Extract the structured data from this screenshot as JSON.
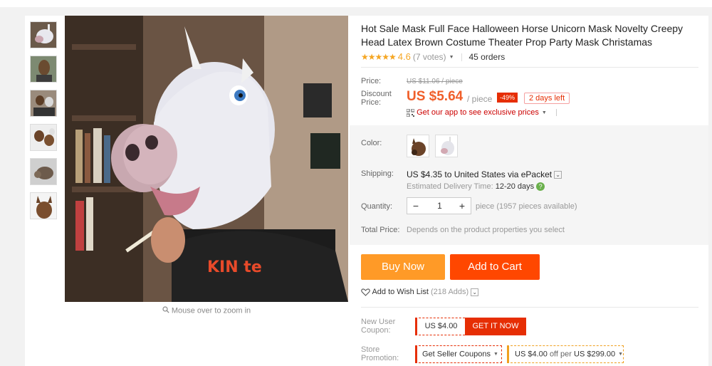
{
  "product": {
    "title": "Hot Sale Mask Full Face Halloween Horse Unicorn Mask Novelty Creepy Head Latex Brown Costume Theater Prop Party Mask Christamas",
    "rating_stars": "★★★★★",
    "rating_score": "4.6",
    "votes": "(7 votes)",
    "orders": "45 orders"
  },
  "gallery": {
    "thumbnails": [
      "unicorn-thumb",
      "horse-thumb",
      "people-thumb",
      "horses-thumb",
      "horse-gray-thumb",
      "horse-brown-thumb"
    ],
    "zoom_hint": "Mouse over to zoom in"
  },
  "pricing": {
    "price_label": "Price:",
    "old_price": "US $11.06 / piece",
    "discount_label": "Discount Price:",
    "price": "US $5.64",
    "per": "/ piece",
    "discount_badge": "-49%",
    "days_left": "2 days left",
    "app_promo": "Get our app to see exclusive prices"
  },
  "options": {
    "color_label": "Color:",
    "shipping_label": "Shipping:",
    "shipping_value": "US $4.35 to United States via ePacket",
    "estimated_label": "Estimated Delivery Time:",
    "estimated_value": "12-20 days",
    "quantity_label": "Quantity:",
    "quantity_value": "1",
    "availability": "piece (1957 pieces available)",
    "total_label": "Total Price:",
    "total_value": "Depends on the product properties you select"
  },
  "actions": {
    "buy_now": "Buy Now",
    "add_to_cart": "Add to Cart",
    "wish_list": "Add to Wish List",
    "wish_count": "(218 Adds)"
  },
  "coupons": {
    "new_user_label": "New User Coupon:",
    "coupon_amount": "US $4.00",
    "get_it_now": "GET IT NOW",
    "store_label": "Store Promotion:",
    "seller_coupons": "Get Seller Coupons",
    "promo_amount": "US $4.00",
    "promo_off": "off per",
    "promo_threshold": "US $299.00"
  },
  "colors": {
    "price_red": "#f05f2a",
    "buy_orange": "#ff9a27",
    "cart_orange": "#ff4700",
    "badge_red": "#e62e04",
    "star": "#f5a623"
  }
}
